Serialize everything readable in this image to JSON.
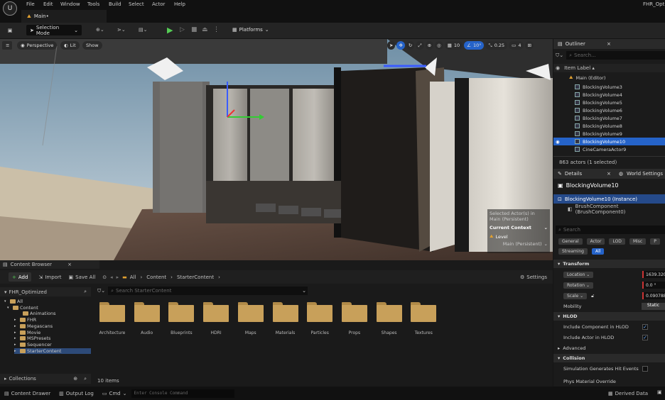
{
  "menubar": {
    "items": [
      "File",
      "Edit",
      "Window",
      "Tools",
      "Build",
      "Select",
      "Actor",
      "Help"
    ],
    "project_name": "FHR_Opti"
  },
  "tabs": {
    "level_tab": "Main•"
  },
  "toolbar": {
    "selection_mode": "Selection Mode",
    "platforms": "Platforms"
  },
  "viewport": {
    "perspective": "Perspective",
    "lit": "Lit",
    "show": "Show",
    "grid_snap": "10",
    "rot_snap": "10°",
    "scale_snap": "0.25",
    "cam_speed": "4",
    "overlay": {
      "selected_line1": "Selected Actor(s) in",
      "selected_line2": "Main (Persistent)",
      "current_context": "Current Context",
      "level": "Level",
      "level_value": "Main (Persistent)"
    }
  },
  "outliner": {
    "title": "Outliner",
    "search_placeholder": "Search...",
    "column": "Item Label ▴",
    "root": "Main (Editor)",
    "items": [
      "BlockingVolume3",
      "BlockingVolume4",
      "BlockingVolume5",
      "BlockingVolume6",
      "BlockingVolume7",
      "BlockingVolume8",
      "BlockingVolume9",
      "BlockingVolume10",
      "CineCameraActor9"
    ],
    "selected_index": 7,
    "count": "863 actors (1 selected)"
  },
  "details": {
    "title": "Details",
    "world_settings": "World Settings",
    "actor_name": "BlockingVolume10",
    "instance": "BlockingVolume10 (Instance)",
    "component": "BrushComponent (BrushComponent0)",
    "search_placeholder": "Search",
    "filter_tabs": [
      "General",
      "Actor",
      "LOD",
      "Misc",
      "P"
    ],
    "filter_tabs2": [
      "Streaming",
      "All"
    ],
    "transform": "Transform",
    "location": "Location",
    "location_value": "1639.3205",
    "rotation": "Rotation",
    "rotation_value": "0.0 °",
    "scale": "Scale",
    "scale_value": "0.090788",
    "mobility": "Mobility",
    "mobility_value": "Static",
    "hlod": "HLOD",
    "include_component": "Include Component in HLOD",
    "include_actor": "Include Actor in HLOD",
    "advanced": "Advanced",
    "collision": "Collision",
    "sim_hit": "Simulation Generates Hit Events",
    "phys_mat": "Phys Material Override"
  },
  "content_browser": {
    "title": "Content Browser",
    "add": "Add",
    "import": "Import",
    "save_all": "Save All",
    "breadcrumb": [
      "All",
      "Content",
      "StarterContent"
    ],
    "settings": "Settings",
    "project": "FHR_Optimized",
    "search_placeholder": "Search StarterContent",
    "tree": [
      "All",
      "Content",
      "Animations",
      "FHR",
      "Megascans",
      "Movie",
      "MSPresets",
      "Sequencer",
      "StarterContent"
    ],
    "folders": [
      "Architecture",
      "Audio",
      "Blueprints",
      "HDRI",
      "Maps",
      "Materials",
      "Particles",
      "Props",
      "Shapes",
      "Textures"
    ],
    "item_count": "10 items",
    "collections": "Collections"
  },
  "statusbar": {
    "content_drawer": "Content Drawer",
    "output_log": "Output Log",
    "cmd": "Cmd",
    "console_placeholder": "Enter Console Command",
    "derived_data": "Derived Data"
  }
}
